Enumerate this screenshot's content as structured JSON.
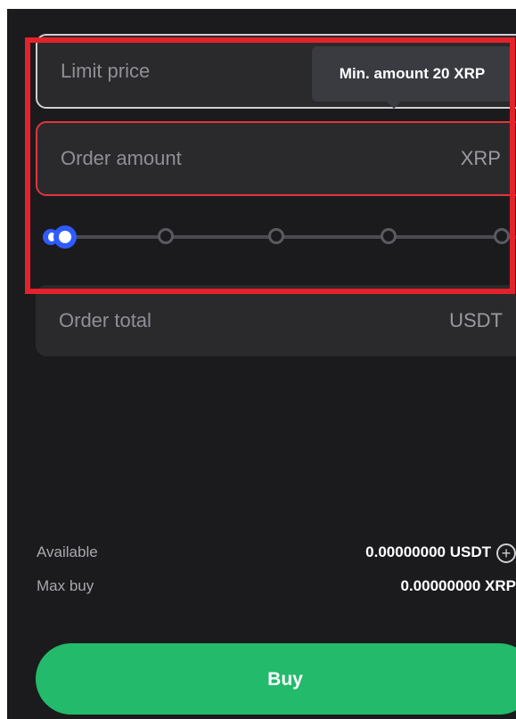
{
  "form": {
    "limit_price": {
      "placeholder": "Limit price"
    },
    "tooltip": {
      "text": "Min. amount 20 XRP"
    },
    "order_amount": {
      "placeholder": "Order amount",
      "unit": "XRP"
    },
    "order_total": {
      "placeholder": "Order total",
      "unit": "USDT"
    },
    "slider": {
      "value_percent": 0,
      "steps": [
        0,
        25,
        50,
        75,
        100
      ]
    }
  },
  "balances": {
    "available": {
      "label": "Available",
      "value": "0.00000000 USDT"
    },
    "max_buy": {
      "label": "Max buy",
      "value": "0.00000000 XRP"
    }
  },
  "actions": {
    "buy_label": "Buy"
  },
  "icons": {
    "add_funds": "plus-circle-icon"
  },
  "colors": {
    "background": "#1b1b1e",
    "input_bg": "#2a2a2d",
    "error_border": "#e0353d",
    "highlight_border": "#e4222b",
    "slider_accent": "#2f5bff",
    "buy_button": "#23ba6b"
  }
}
